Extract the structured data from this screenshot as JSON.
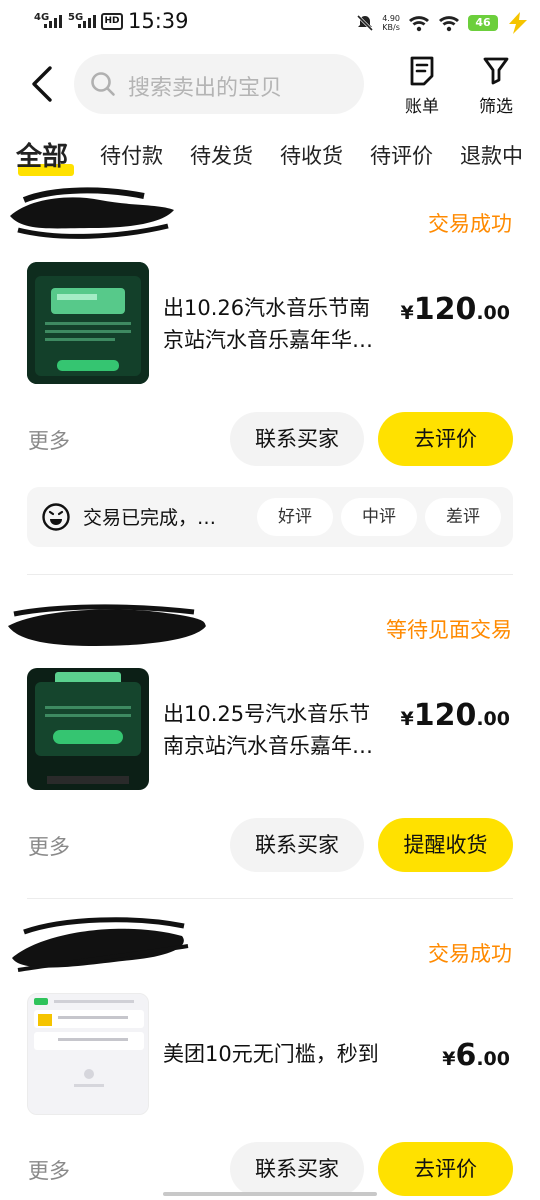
{
  "status_bar": {
    "time": "15:39",
    "net1": "4G",
    "net2": "5G",
    "hd": "HD",
    "speed_value": "4.90",
    "speed_unit": "KB/s",
    "battery": "46"
  },
  "header": {
    "search_placeholder": "搜索卖出的宝贝",
    "bill_label": "账单",
    "filter_label": "筛选"
  },
  "tabs": [
    {
      "label": "全部",
      "active": true
    },
    {
      "label": "待付款"
    },
    {
      "label": "待发货"
    },
    {
      "label": "待收货"
    },
    {
      "label": "待评价"
    },
    {
      "label": "退款中"
    }
  ],
  "orders": [
    {
      "status": "交易成功",
      "title_line1": "出10.26汽水音乐节南",
      "title_line2": "京站汽水音乐嘉年华…",
      "price_currency": "¥",
      "price_int": "120",
      "price_dec": ".00",
      "more_label": "更多",
      "contact_label": "联系买家",
      "action_label": "去评价",
      "review": {
        "text": "交易已完成，…",
        "good": "好评",
        "neutral": "中评",
        "bad": "差评"
      }
    },
    {
      "status": "等待见面交易",
      "title_line1": "出10.25号汽水音乐节",
      "title_line2": "南京站汽水音乐嘉年…",
      "price_currency": "¥",
      "price_int": "120",
      "price_dec": ".00",
      "more_label": "更多",
      "contact_label": "联系买家",
      "action_label": "提醒收货"
    },
    {
      "status": "交易成功",
      "title_line1": "美团10元无门槛，秒到",
      "price_currency": "¥",
      "price_int": "6",
      "price_dec": ".00",
      "more_label": "更多",
      "contact_label": "联系买家",
      "action_label": "去评价"
    }
  ],
  "colors": {
    "accent_yellow": "#ffe100",
    "status_orange": "#ff8a00",
    "muted_gray": "#8a8a8a"
  },
  "icons": [
    "back-icon",
    "search-icon",
    "bill-icon",
    "filter-icon",
    "emoji-icon"
  ]
}
